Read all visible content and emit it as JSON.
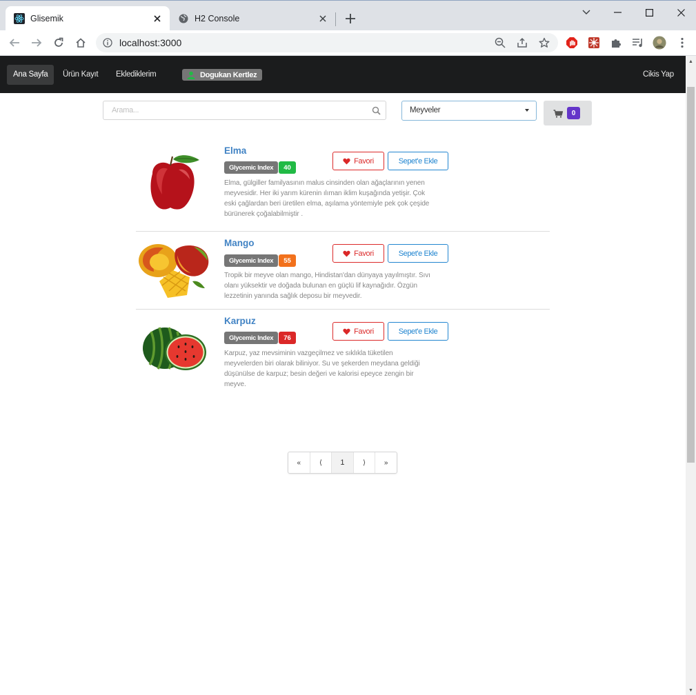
{
  "browser": {
    "tabs": [
      {
        "title": "Glisemik",
        "active": true
      },
      {
        "title": "H2 Console",
        "active": false
      }
    ],
    "url": "localhost:3000"
  },
  "navbar": {
    "items": [
      "Ana Sayfa",
      "Ürün Kayıt",
      "Eklediklerim"
    ],
    "user": "Dogukan Kertlez",
    "logout": "Cikis Yap"
  },
  "search": {
    "placeholder": "Arama..."
  },
  "category": {
    "selected": "Meyveler"
  },
  "cart": {
    "count": "0"
  },
  "buttons": {
    "favorite": "Favori",
    "add_to_cart": "Sepet'e Ekle"
  },
  "gi_label": "Glycemic Index",
  "products": [
    {
      "name": "Elma",
      "gi": "40",
      "gi_color": "#21ba45",
      "description": "Elma, gülgiller familyasının malus cinsinden olan ağaçlarının yenen meyvesidir. Her iki yarım kürenin ılıman iklim kuşağında yetişir. Çok eski çağlardan beri üretilen elma, aşılama yöntemiyle pek çok çeşide bürünerek çoğalabilmiştir ."
    },
    {
      "name": "Mango",
      "gi": "55",
      "gi_color": "#f2711c",
      "description": "Tropik bir meyve olan mango, Hindistan'dan dünyaya yayılmıştır. Sıvı olanı yüksektir ve doğada bulunan en güçlü lif kaynağıdır. Özgün lezzetinin yanında sağlık deposu bir meyvedir."
    },
    {
      "name": "Karpuz",
      "gi": "76",
      "gi_color": "#db2828",
      "description": "Karpuz, yaz mevsiminin vazgeçilmez ve sıklıkla tüketilen meyvelerden biri olarak biliniyor. Su ve şekerden meydana geldiği düşünülse de karpuz; besin değeri ve kalorisi epeyce zengin bir meyve."
    }
  ],
  "pagination": {
    "first": "«",
    "prev": "⟨",
    "current": "1",
    "next": "⟩",
    "last": "»"
  }
}
